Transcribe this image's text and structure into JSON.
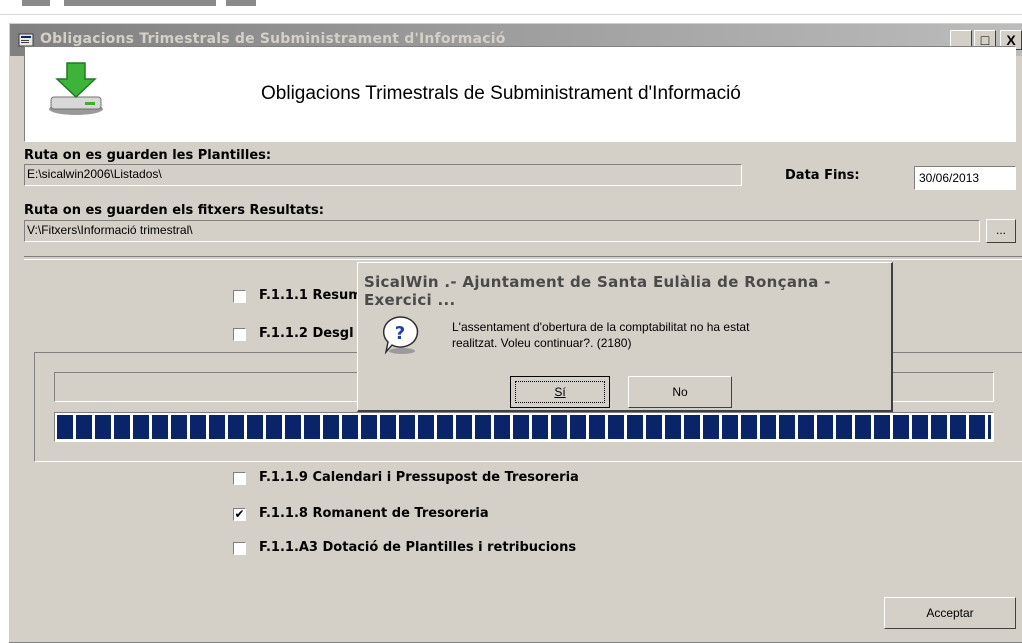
{
  "window": {
    "title": "Obligacions Trimestrals de Subministrament d'Informació",
    "minimize": "_",
    "maximize": "□",
    "close": "X"
  },
  "banner": {
    "icon": "download-drive-icon",
    "title": "Obligacions Trimestrals de Subministrament d'Informació"
  },
  "form": {
    "templates_label": "Ruta on es guarden les Plantilles:",
    "templates_path": "E:\\sicalwin2006\\Listados\\",
    "date_label": "Data Fins:",
    "date_value": "30/06/2013",
    "results_label": "Ruta on es guarden els fitxers Resultats:",
    "results_path": "V:\\Fitxers\\Informació trimestral\\",
    "browse_label": "..."
  },
  "checkboxes": [
    {
      "label": "F.1.1.1 Resum",
      "checked": false
    },
    {
      "label": "F.1.1.2 Desgl",
      "checked": false
    },
    {
      "label": "F.1.1.9 Calendari i Pressupost de Tresoreria",
      "checked": false
    },
    {
      "label": "F.1.1.8 Romanent de Tresoreria",
      "checked": true
    },
    {
      "label": "F.1.1.A3 Dotació de Plantilles i retribucions",
      "checked": false
    }
  ],
  "progress": {
    "percent": 100,
    "color": "#0a246a"
  },
  "accept_button": "Acceptar",
  "dialog": {
    "title": "SicalWin .- Ajuntament de Santa Eulàlia de Ronçana -Exercici ...",
    "icon": "question-icon",
    "message_line1": "L'assentament d'obertura de la comptabilitat no ha estat",
    "message_line2": "realitzat. Voleu continuar?. (2180)",
    "yes_label": "Sí",
    "no_label": "No"
  }
}
